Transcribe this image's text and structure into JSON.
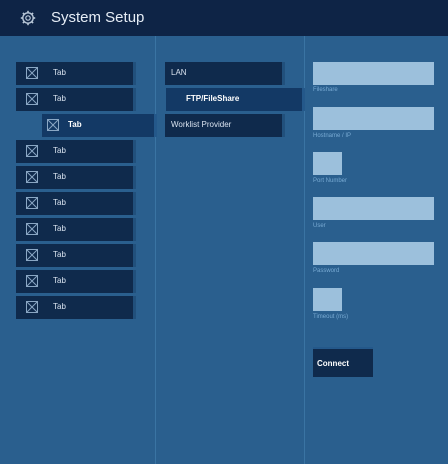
{
  "header": {
    "title": "System Setup",
    "icon": "gear-icon"
  },
  "tabs": [
    {
      "label": "Tab",
      "selected": false
    },
    {
      "label": "Tab",
      "selected": false
    },
    {
      "label": "Tab",
      "selected": true
    },
    {
      "label": "Tab",
      "selected": false
    },
    {
      "label": "Tab",
      "selected": false
    },
    {
      "label": "Tab",
      "selected": false
    },
    {
      "label": "Tab",
      "selected": false
    },
    {
      "label": "Tab",
      "selected": false
    },
    {
      "label": "Tab",
      "selected": false
    },
    {
      "label": "Tab",
      "selected": false
    }
  ],
  "subtabs": [
    {
      "label": "LAN",
      "selected": false
    },
    {
      "label": "FTP/FileShare",
      "selected": true
    },
    {
      "label": "Worklist Provider",
      "selected": false
    }
  ],
  "form": {
    "fileshare": {
      "label": "Fileshare",
      "value": ""
    },
    "hostname": {
      "label": "Hostname / IP",
      "value": ""
    },
    "port": {
      "label": "Port Number",
      "value": ""
    },
    "user": {
      "label": "User",
      "value": ""
    },
    "password": {
      "label": "Password",
      "value": ""
    },
    "timeout": {
      "label": "Timeout (ms)",
      "value": ""
    },
    "connect_label": "Connect"
  },
  "colors": {
    "background": "#2a5f8e",
    "titlebar": "#0e2446",
    "tab": "#0f2a4c",
    "tab_selected": "#133965",
    "field": "#9cc0dc"
  }
}
